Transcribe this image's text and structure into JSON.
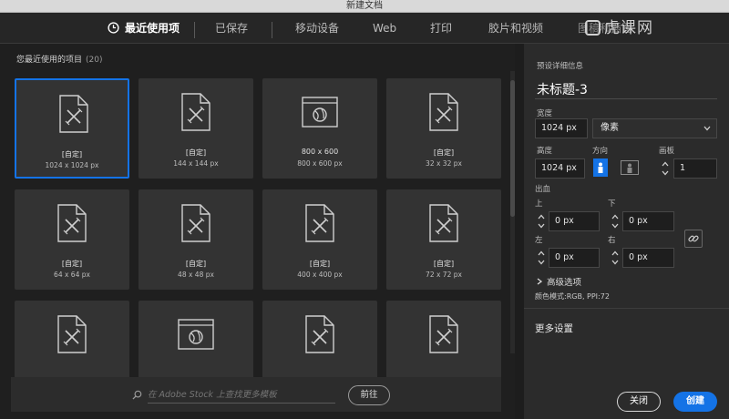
{
  "window": {
    "title": "新建文档"
  },
  "tabs": [
    {
      "label": "最近使用项",
      "active": true
    },
    {
      "label": "已保存",
      "active": false
    },
    {
      "label": "移动设备",
      "active": false
    },
    {
      "label": "Web",
      "active": false
    },
    {
      "label": "打印",
      "active": false
    },
    {
      "label": "胶片和视频",
      "active": false
    },
    {
      "label": "图稿和插图",
      "active": false
    }
  ],
  "watermark": {
    "text": "虎课网"
  },
  "recent": {
    "title": "您最近使用的项目",
    "count": "(20)",
    "items": [
      {
        "name": "[自定]",
        "size": "1024 x 1024 px",
        "icon": "document-icon",
        "selected": true
      },
      {
        "name": "[自定]",
        "size": "144 x 144 px",
        "icon": "document-icon"
      },
      {
        "name": "800 x 600",
        "size": "800 x 600 px",
        "icon": "web-browser-icon"
      },
      {
        "name": "[自定]",
        "size": "32 x 32 px",
        "icon": "document-icon"
      },
      {
        "name": "[自定]",
        "size": "64 x 64 px",
        "icon": "document-icon"
      },
      {
        "name": "[自定]",
        "size": "48 x 48 px",
        "icon": "document-icon"
      },
      {
        "name": "[自定]",
        "size": "400 x 400 px",
        "icon": "document-icon"
      },
      {
        "name": "[自定]",
        "size": "72 x 72 px",
        "icon": "document-icon"
      },
      {
        "name": "",
        "size": "",
        "icon": "document-icon"
      },
      {
        "name": "",
        "size": "",
        "icon": "web-browser-icon"
      },
      {
        "name": "",
        "size": "",
        "icon": "document-icon"
      },
      {
        "name": "",
        "size": "",
        "icon": "document-icon"
      }
    ]
  },
  "stock": {
    "placeholder": "在 Adobe Stock 上查找更多模板",
    "go_label": "前往"
  },
  "details": {
    "section_label": "预设详细信息",
    "doc_title": "未标题-3",
    "width_label": "宽度",
    "width_value": "1024 px",
    "unit_value": "像素",
    "height_label": "高度",
    "height_value": "1024 px",
    "orientation_label": "方向",
    "artboards_label": "画板",
    "artboards_value": "1",
    "bleed_label": "出血",
    "top_label": "上",
    "top_value": "0 px",
    "bottom_label": "下",
    "bottom_value": "0 px",
    "left_label": "左",
    "left_value": "0 px",
    "right_label": "右",
    "right_value": "0 px",
    "advanced_label": "高级选项",
    "color_mode": "颜色模式:RGB, PPI:72",
    "more_settings": "更多设置"
  },
  "actions": {
    "close_label": "关闭",
    "create_label": "创建"
  },
  "colors": {
    "accent": "#1473e6",
    "panel": "#2b2b2b",
    "card": "#333333"
  }
}
